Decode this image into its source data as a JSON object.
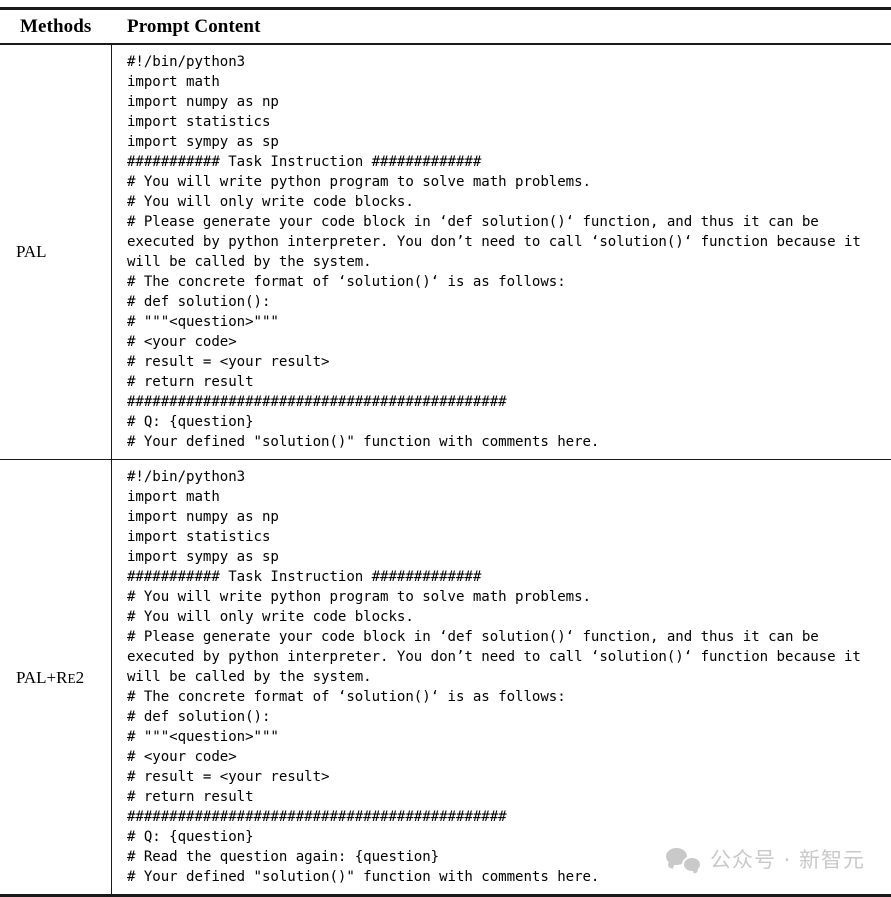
{
  "table": {
    "headers": {
      "methods": "Methods",
      "prompt_content": "Prompt Content"
    },
    "rows": [
      {
        "method_main": "PAL",
        "method_sub": "",
        "method_suffix": "",
        "prompt": "#!/bin/python3\nimport math\nimport numpy as np\nimport statistics\nimport sympy as sp\n########### Task Instruction #############\n# You will write python program to solve math problems.\n# You will only write code blocks.\n# Please generate your code block in ‘def solution()‘ function, and thus it can be executed by python interpreter. You don’t need to call ‘solution()‘ function because it will be called by the system.\n# The concrete format of ‘solution()‘ is as follows:\n# def solution():\n# \"\"\"<question>\"\"\"\n# <your code>\n# result = <your result>\n# return result\n#############################################\n# Q: {question}\n# Your defined \"solution()\" function with comments here."
      },
      {
        "method_main": "PAL+R",
        "method_sub": "E",
        "method_suffix": "2",
        "prompt": "#!/bin/python3\nimport math\nimport numpy as np\nimport statistics\nimport sympy as sp\n########### Task Instruction #############\n# You will write python program to solve math problems.\n# You will only write code blocks.\n# Please generate your code block in ‘def solution()‘ function, and thus it can be executed by python interpreter. You don’t need to call ‘solution()‘ function because it will be called by the system.\n# The concrete format of ‘solution()‘ is as follows:\n# def solution():\n# \"\"\"<question>\"\"\"\n# <your code>\n# result = <your result>\n# return result\n#############################################\n# Q: {question}\n# Read the question again: {question}\n# Your defined \"solution()\" function with comments here."
      }
    ]
  },
  "watermark": {
    "icon": "wechat-icon",
    "text": "公众号 · 新智元"
  }
}
